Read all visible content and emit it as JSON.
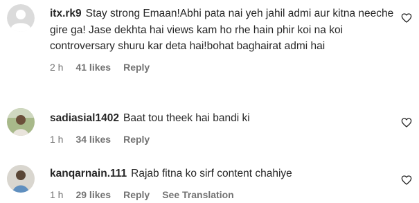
{
  "comments": [
    {
      "username": "itx.rk9",
      "text": "Stay strong Emaan!Abhi pata nai yeh jahil admi aur kitna neeche gire ga! Jase dekhta hai views kam ho rhe hain phir koi na koi controversary shuru kar deta hai!bohat baghairat admi hai",
      "time": "2 h",
      "likes": "41 likes",
      "reply": "Reply",
      "avatar_icon": "default-avatar-icon",
      "like_icon": "heart-outline-icon"
    },
    {
      "username": "sadiasial1402",
      "text": "Baat tou theek hai bandi ki",
      "time": "1 h",
      "likes": "34 likes",
      "reply": "Reply",
      "avatar_icon": "profile-photo-avatar",
      "like_icon": "heart-outline-icon"
    },
    {
      "username": "kanqarnain.111",
      "text": "Rajab fitna ko sirf content chahiye",
      "time": "1 h",
      "likes": "29 likes",
      "reply": "Reply",
      "see_translation": "See Translation",
      "avatar_icon": "profile-photo-avatar",
      "like_icon": "heart-outline-icon"
    }
  ],
  "colors": {
    "text": "#262626",
    "meta": "#737373",
    "default_avatar_bg": "#dbdbdb"
  }
}
